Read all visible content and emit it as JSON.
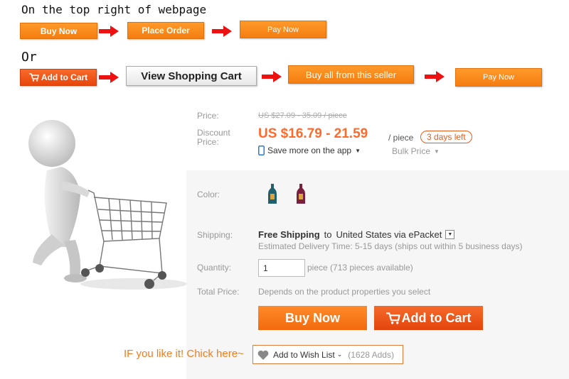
{
  "instructions": {
    "heading_top": "On the top right of webpage",
    "heading_or": "Or",
    "row1": [
      "Buy Now",
      "Place Order",
      "Pay Now"
    ],
    "row2": [
      "Add to Cart",
      "View Shopping Cart",
      "Buy all from this seller",
      "Pay Now"
    ]
  },
  "product": {
    "price_label": "Price:",
    "old_price": "US $27.09 - 35.09 / piece",
    "discount_label": "Discount Price:",
    "new_price": "US $16.79 - 21.59",
    "per_piece": "/ piece",
    "days_left": "3 days left",
    "app_text": "Save more on the app",
    "bulk_price": "Bulk Price",
    "color_label": "Color:",
    "swatch_colors": [
      "#1f5f6e",
      "#7a1f3c"
    ],
    "shipping_label": "Shipping:",
    "free_shipping": "Free Shipping",
    "shipping_to": "to",
    "shipping_dest": "United States via ePacket",
    "delivery": "Estimated Delivery Time: 5-15 days (ships out within 5 business days)",
    "quantity_label": "Quantity:",
    "quantity_value": "1",
    "quantity_avail": "piece (713 pieces available)",
    "total_label": "Total Price:",
    "total_value": "Depends on the product properties you select",
    "buy_now": "Buy Now",
    "add_to_cart": "Add to Cart",
    "wish_prompt": "IF you like it! Chick here~",
    "wish_label": "Add to Wish List",
    "wish_count": "(1628 Adds)"
  },
  "colors": {
    "orange": "#f47d10",
    "red_orange": "#e8460c",
    "price_orange": "#ff6a2a"
  }
}
